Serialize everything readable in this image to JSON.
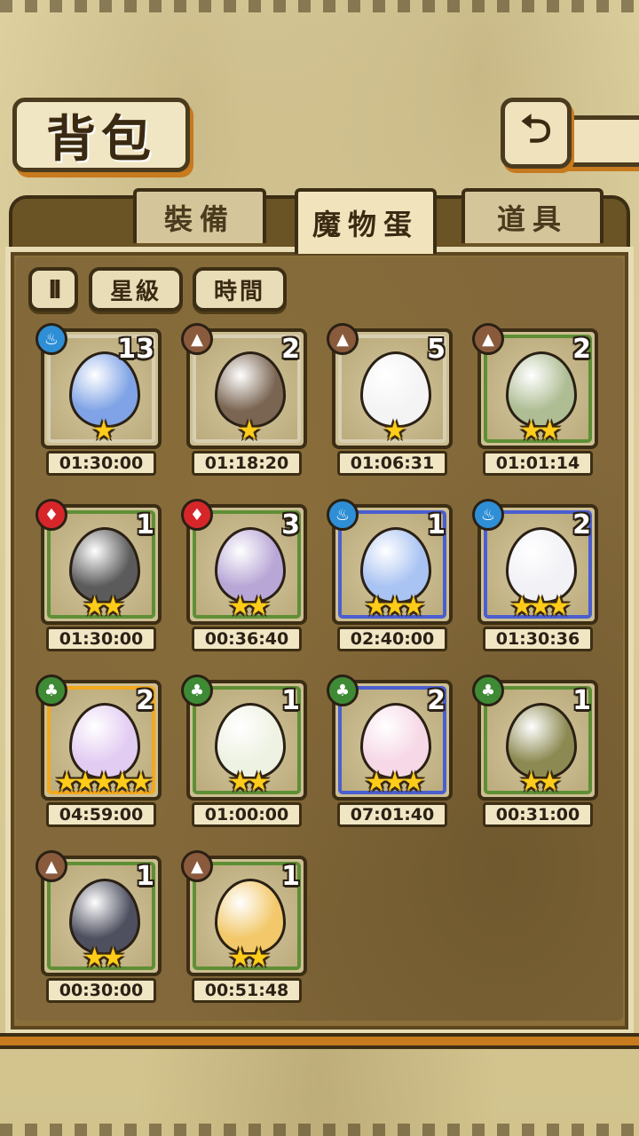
{
  "header": {
    "title": "背包"
  },
  "tabs": [
    {
      "label": "裝備",
      "active": false
    },
    {
      "label": "魔物蛋",
      "active": true
    },
    {
      "label": "道具",
      "active": false
    }
  ],
  "sort": {
    "toggle_icon": "ll",
    "star_label": "星級",
    "time_label": "時間"
  },
  "eggs": [
    {
      "element": "water",
      "count": "13",
      "stars": "★",
      "time": "01:30:00",
      "rarity": "white",
      "color": "#7fa3e6"
    },
    {
      "element": "earth",
      "count": "2",
      "stars": "★",
      "time": "01:18:20",
      "rarity": "white",
      "color": "#7a6552"
    },
    {
      "element": "earth",
      "count": "5",
      "stars": "★",
      "time": "01:06:31",
      "rarity": "white",
      "color": "#f4f4f4"
    },
    {
      "element": "earth",
      "count": "2",
      "stars": "★★",
      "time": "01:01:14",
      "rarity": "green",
      "color": "#aebd94"
    },
    {
      "element": "fire",
      "count": "1",
      "stars": "★★",
      "time": "01:30:00",
      "rarity": "green",
      "color": "#5b5b5b"
    },
    {
      "element": "fire",
      "count": "3",
      "stars": "★★",
      "time": "00:36:40",
      "rarity": "green",
      "color": "#b8a6d6"
    },
    {
      "element": "water",
      "count": "1",
      "stars": "★★★",
      "time": "02:40:00",
      "rarity": "blue",
      "color": "#a9c3f2"
    },
    {
      "element": "water",
      "count": "2",
      "stars": "★★★",
      "time": "01:30:36",
      "rarity": "blue",
      "color": "#f1f1f6"
    },
    {
      "element": "plant",
      "count": "2",
      "stars": "★★★★★",
      "time": "04:59:00",
      "rarity": "gold",
      "color": "#e3ccf2"
    },
    {
      "element": "plant",
      "count": "1",
      "stars": "★★",
      "time": "01:00:00",
      "rarity": "green",
      "color": "#eef2e2"
    },
    {
      "element": "plant",
      "count": "2",
      "stars": "★★★",
      "time": "07:01:40",
      "rarity": "blue",
      "color": "#f6d8e6"
    },
    {
      "element": "plant",
      "count": "1",
      "stars": "★★",
      "time": "00:31:00",
      "rarity": "green",
      "color": "#8c8a52"
    },
    {
      "element": "earth",
      "count": "1",
      "stars": "★★",
      "time": "00:30:00",
      "rarity": "green",
      "color": "#4e5060"
    },
    {
      "element": "earth",
      "count": "1",
      "stars": "★★",
      "time": "00:51:48",
      "rarity": "green",
      "color": "#f2c86a"
    }
  ],
  "element_icons": {
    "water": "♨",
    "earth": "▲",
    "fire": "♦",
    "plant": "♣"
  }
}
